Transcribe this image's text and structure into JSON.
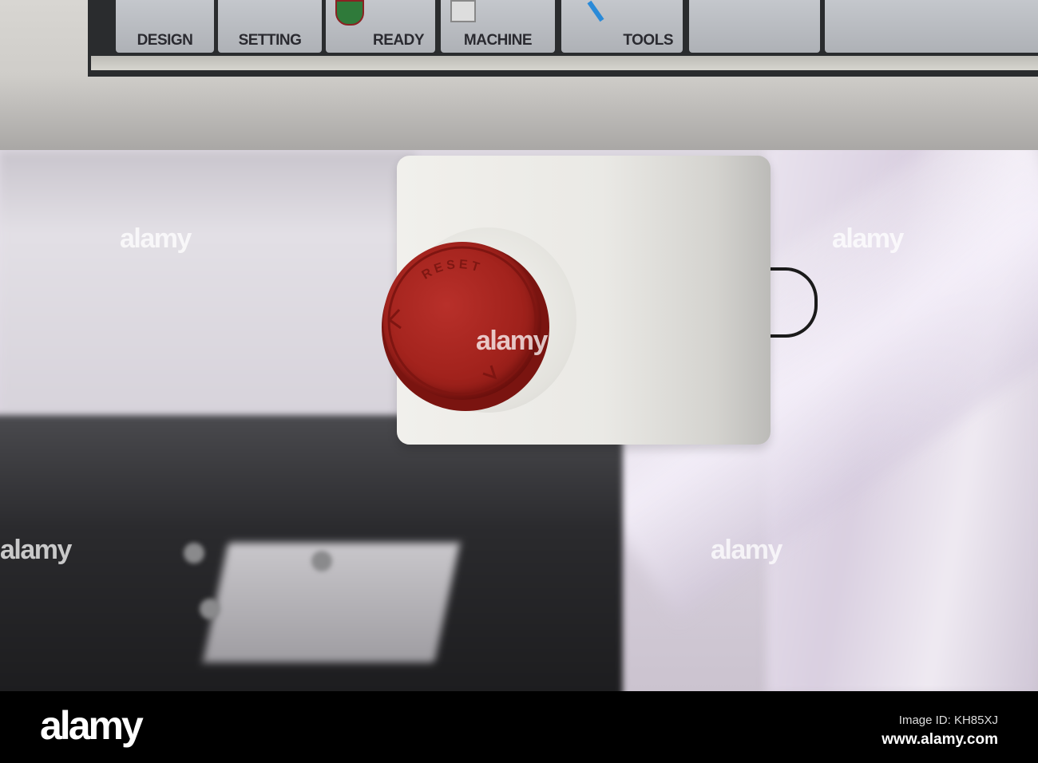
{
  "screen_tabs": [
    {
      "label": "DESIGN",
      "icon": "design-icon"
    },
    {
      "label": "SETTING",
      "icon": "gear-icon"
    },
    {
      "label": "READY",
      "icon": "shield-check-icon"
    },
    {
      "label": "MACHINE",
      "icon": "network-icon"
    },
    {
      "label": "TOOLS",
      "icon": "tools-icon"
    },
    {
      "label": ""
    },
    {
      "label": ""
    }
  ],
  "button": {
    "cap_text": "RESET",
    "cap_color": "#a3231d"
  },
  "watermark": {
    "text": "alamy"
  },
  "footer": {
    "logo": "alamy",
    "image_id": "Image ID: KH85XJ",
    "url": "www.alamy.com"
  }
}
